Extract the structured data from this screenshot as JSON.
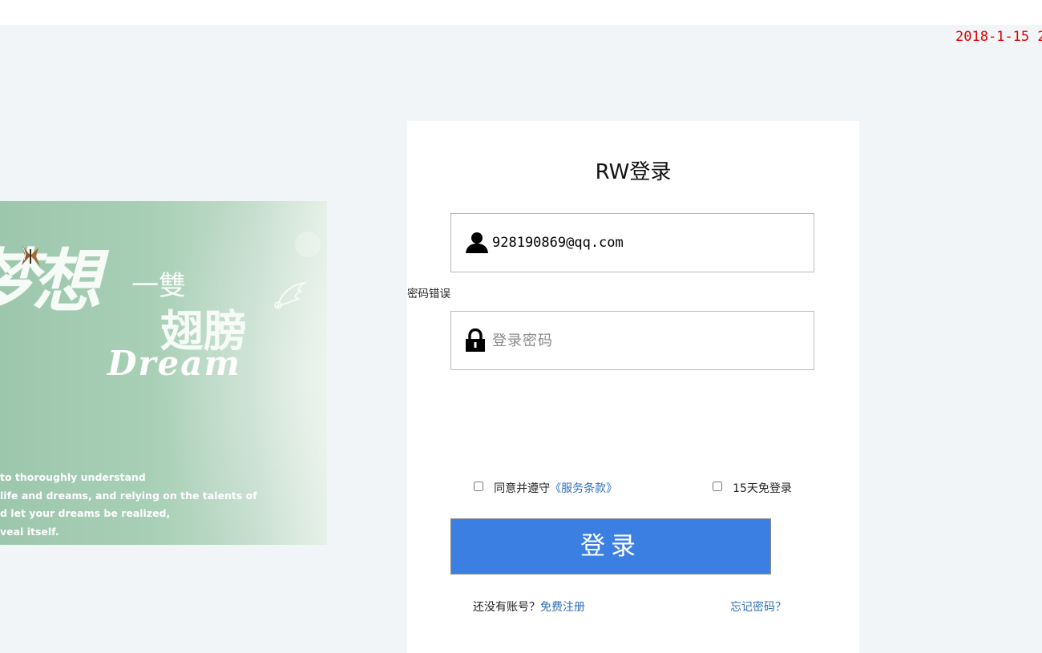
{
  "header": {
    "datetime": "2018-1-15 2"
  },
  "banner": {
    "calligraphy_1": "梦想",
    "calligraphy_2": "一雙",
    "calligraphy_3": "翅膀",
    "dream_word": "Dream",
    "english_lines": [
      "to thoroughly understand",
      "life and dreams, and relying on the talents of",
      "d let your dreams be realized,",
      "veal itself."
    ]
  },
  "login": {
    "title": "RW登录",
    "email": {
      "value": "928190869@qq.com",
      "icon": "user-icon"
    },
    "password_error": "密码错误",
    "password": {
      "placeholder": "登录密码",
      "value": "",
      "icon": "lock-icon"
    },
    "agree": {
      "label": "同意并遵守",
      "link": "《服务条款》",
      "checked": false
    },
    "remember": {
      "label": "15天免登录",
      "checked": false
    },
    "submit_label": "登录",
    "no_account_text": "还没有账号？",
    "register_link": "免费注册",
    "forgot_link": "忘记密码？"
  },
  "colors": {
    "page_background": "#f2f5f8",
    "card_background": "#ffffff",
    "button": "#3b7fe2",
    "link": "#2f6fb8",
    "datetime": "#e00000"
  }
}
